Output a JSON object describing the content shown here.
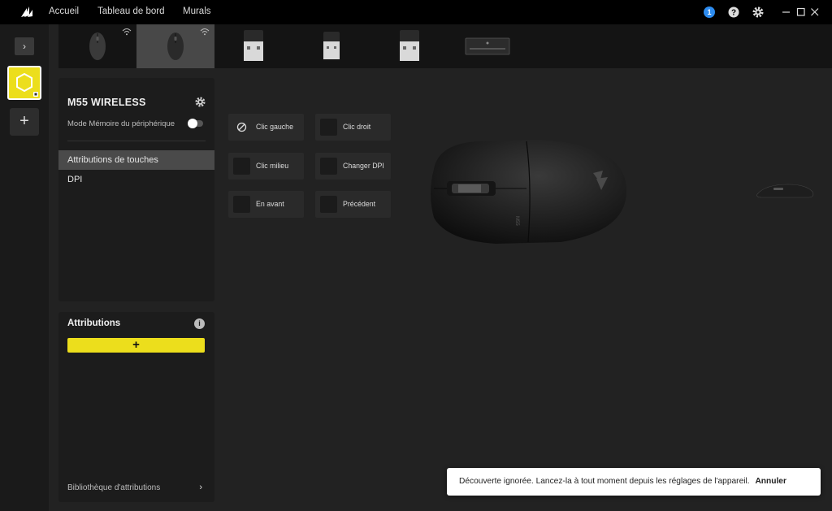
{
  "nav": {
    "home": "Accueil",
    "dashboard": "Tableau de bord",
    "murals": "Murals",
    "notification_count": "1"
  },
  "icons": {
    "logo": "corsair-sails-icon",
    "help": "question-icon",
    "settings": "gear-icon",
    "minimize": "minimize-icon",
    "maximize": "maximize-icon",
    "close": "close-icon"
  },
  "rail": {
    "toggle": "›",
    "add": "+"
  },
  "device": {
    "name": "M55 WIRELESS",
    "memory_mode_label": "Mode Mémoire du périphérique"
  },
  "menu": {
    "items": [
      {
        "label": "Attributions de touches"
      },
      {
        "label": "DPI"
      }
    ]
  },
  "assignments": {
    "title": "Attributions",
    "add": "+",
    "library": "Bibliothèque d'attributions",
    "chevron": "›"
  },
  "buttons": [
    {
      "label": "Clic gauche"
    },
    {
      "label": "Clic droit"
    },
    {
      "label": "Clic milieu"
    },
    {
      "label": "Changer DPI"
    },
    {
      "label": "En avant"
    },
    {
      "label": "Précédent"
    }
  ],
  "toast": {
    "message": "Découverte ignorée. Lancez-la à tout moment depuis les réglages de l'appareil.",
    "action": "Annuler"
  },
  "colors": {
    "accent": "#ecde1c",
    "selected_tab": "#484848",
    "badge": "#2d8cf0"
  }
}
